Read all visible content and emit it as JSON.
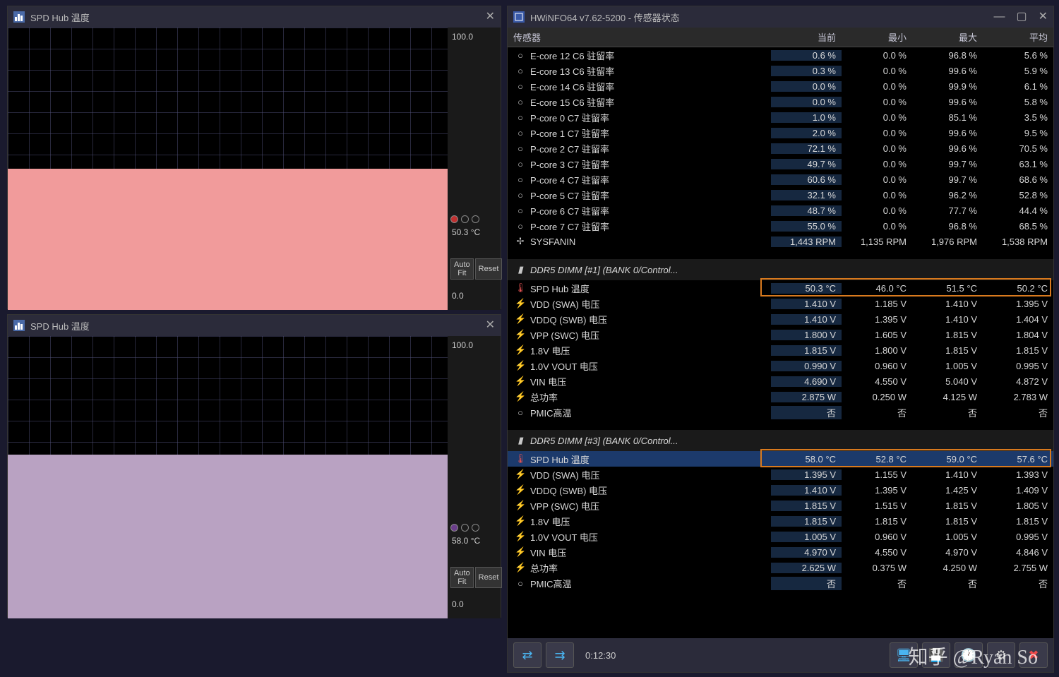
{
  "graph1": {
    "title": "SPD Hub 温度",
    "ymax": "100.0",
    "current": "50.3 °C",
    "ymin": "0.0",
    "autofit": "Auto Fit",
    "reset": "Reset",
    "fill_color": "#f19b9b",
    "fill_pct": 50,
    "dot_color": "#c03030"
  },
  "graph2": {
    "title": "SPD Hub 温度",
    "ymax": "100.0",
    "current": "58.0 °C",
    "ymin": "0.0",
    "autofit": "Auto Fit",
    "reset": "Reset",
    "fill_color": "#b9a2c2",
    "fill_pct": 58,
    "dot_color": "#6a3d8a"
  },
  "hwinfo": {
    "title": "HWiNFO64 v7.62-5200 - 传感器状态",
    "headers": {
      "sensor": "传感器",
      "cur": "当前",
      "min": "最小",
      "max": "最大",
      "avg": "平均"
    },
    "timer": "0:12:30",
    "rows": [
      {
        "type": "item",
        "icon": "○",
        "name": "E-core 12 C6 驻留率",
        "cur": "0.6 %",
        "min": "0.0 %",
        "max": "96.8 %",
        "avg": "5.6 %"
      },
      {
        "type": "item",
        "icon": "○",
        "name": "E-core 13 C6 驻留率",
        "cur": "0.3 %",
        "min": "0.0 %",
        "max": "99.6 %",
        "avg": "5.9 %"
      },
      {
        "type": "item",
        "icon": "○",
        "name": "E-core 14 C6 驻留率",
        "cur": "0.0 %",
        "min": "0.0 %",
        "max": "99.9 %",
        "avg": "6.1 %"
      },
      {
        "type": "item",
        "icon": "○",
        "name": "E-core 15 C6 驻留率",
        "cur": "0.0 %",
        "min": "0.0 %",
        "max": "99.6 %",
        "avg": "5.8 %"
      },
      {
        "type": "item",
        "icon": "○",
        "name": "P-core 0 C7 驻留率",
        "cur": "1.0 %",
        "min": "0.0 %",
        "max": "85.1 %",
        "avg": "3.5 %"
      },
      {
        "type": "item",
        "icon": "○",
        "name": "P-core 1 C7 驻留率",
        "cur": "2.0 %",
        "min": "0.0 %",
        "max": "99.6 %",
        "avg": "9.5 %"
      },
      {
        "type": "item",
        "icon": "○",
        "name": "P-core 2 C7 驻留率",
        "cur": "72.1 %",
        "min": "0.0 %",
        "max": "99.6 %",
        "avg": "70.5 %"
      },
      {
        "type": "item",
        "icon": "○",
        "name": "P-core 3 C7 驻留率",
        "cur": "49.7 %",
        "min": "0.0 %",
        "max": "99.7 %",
        "avg": "63.1 %"
      },
      {
        "type": "item",
        "icon": "○",
        "name": "P-core 4 C7 驻留率",
        "cur": "60.6 %",
        "min": "0.0 %",
        "max": "99.7 %",
        "avg": "68.6 %"
      },
      {
        "type": "item",
        "icon": "○",
        "name": "P-core 5 C7 驻留率",
        "cur": "32.1 %",
        "min": "0.0 %",
        "max": "96.2 %",
        "avg": "52.8 %"
      },
      {
        "type": "item",
        "icon": "○",
        "name": "P-core 6 C7 驻留率",
        "cur": "48.7 %",
        "min": "0.0 %",
        "max": "77.7 %",
        "avg": "44.4 %"
      },
      {
        "type": "item",
        "icon": "○",
        "name": "P-core 7 C7 驻留率",
        "cur": "55.0 %",
        "min": "0.0 %",
        "max": "96.8 %",
        "avg": "68.5 %"
      },
      {
        "type": "item",
        "icon": "✢",
        "name": "SYSFANIN",
        "cur": "1,443 RPM",
        "min": "1,135 RPM",
        "max": "1,976 RPM",
        "avg": "1,538 RPM"
      },
      {
        "type": "spacer"
      },
      {
        "type": "group",
        "icon": "▮",
        "name": "DDR5 DIMM [#1] (BANK 0/Control..."
      },
      {
        "type": "item",
        "icon": "🌡",
        "name": "SPD Hub 温度",
        "cur": "50.3 °C",
        "min": "46.0 °C",
        "max": "51.5 °C",
        "avg": "50.2 °C",
        "hl": true
      },
      {
        "type": "item",
        "icon": "⚡",
        "name": "VDD (SWA) 电压",
        "cur": "1.410 V",
        "min": "1.185 V",
        "max": "1.410 V",
        "avg": "1.395 V"
      },
      {
        "type": "item",
        "icon": "⚡",
        "name": "VDDQ (SWB) 电压",
        "cur": "1.410 V",
        "min": "1.395 V",
        "max": "1.410 V",
        "avg": "1.404 V"
      },
      {
        "type": "item",
        "icon": "⚡",
        "name": "VPP (SWC) 电压",
        "cur": "1.800 V",
        "min": "1.605 V",
        "max": "1.815 V",
        "avg": "1.804 V"
      },
      {
        "type": "item",
        "icon": "⚡",
        "name": "1.8V 电压",
        "cur": "1.815 V",
        "min": "1.800 V",
        "max": "1.815 V",
        "avg": "1.815 V"
      },
      {
        "type": "item",
        "icon": "⚡",
        "name": "1.0V VOUT 电压",
        "cur": "0.990 V",
        "min": "0.960 V",
        "max": "1.005 V",
        "avg": "0.995 V"
      },
      {
        "type": "item",
        "icon": "⚡",
        "name": "VIN 电压",
        "cur": "4.690 V",
        "min": "4.550 V",
        "max": "5.040 V",
        "avg": "4.872 V"
      },
      {
        "type": "item",
        "icon": "⚡",
        "name": "总功率",
        "cur": "2.875 W",
        "min": "0.250 W",
        "max": "4.125 W",
        "avg": "2.783 W"
      },
      {
        "type": "item",
        "icon": "○",
        "name": "PMIC高温",
        "cur": "否",
        "min": "否",
        "max": "否",
        "avg": "否"
      },
      {
        "type": "spacer"
      },
      {
        "type": "group",
        "icon": "▮",
        "name": "DDR5 DIMM [#3] (BANK 0/Control..."
      },
      {
        "type": "item",
        "icon": "🌡",
        "name": "SPD Hub 温度",
        "cur": "58.0 °C",
        "min": "52.8 °C",
        "max": "59.0 °C",
        "avg": "57.6 °C",
        "sel": true,
        "hl": true
      },
      {
        "type": "item",
        "icon": "⚡",
        "name": "VDD (SWA) 电压",
        "cur": "1.395 V",
        "min": "1.155 V",
        "max": "1.410 V",
        "avg": "1.393 V"
      },
      {
        "type": "item",
        "icon": "⚡",
        "name": "VDDQ (SWB) 电压",
        "cur": "1.410 V",
        "min": "1.395 V",
        "max": "1.425 V",
        "avg": "1.409 V"
      },
      {
        "type": "item",
        "icon": "⚡",
        "name": "VPP (SWC) 电压",
        "cur": "1.815 V",
        "min": "1.515 V",
        "max": "1.815 V",
        "avg": "1.805 V"
      },
      {
        "type": "item",
        "icon": "⚡",
        "name": "1.8V 电压",
        "cur": "1.815 V",
        "min": "1.815 V",
        "max": "1.815 V",
        "avg": "1.815 V"
      },
      {
        "type": "item",
        "icon": "⚡",
        "name": "1.0V VOUT 电压",
        "cur": "1.005 V",
        "min": "0.960 V",
        "max": "1.005 V",
        "avg": "0.995 V"
      },
      {
        "type": "item",
        "icon": "⚡",
        "name": "VIN 电压",
        "cur": "4.970 V",
        "min": "4.550 V",
        "max": "4.970 V",
        "avg": "4.846 V"
      },
      {
        "type": "item",
        "icon": "⚡",
        "name": "总功率",
        "cur": "2.625 W",
        "min": "0.375 W",
        "max": "4.250 W",
        "avg": "2.755 W"
      },
      {
        "type": "item",
        "icon": "○",
        "name": "PMIC高温",
        "cur": "否",
        "min": "否",
        "max": "否",
        "avg": "否"
      }
    ]
  },
  "watermark": "知乎 @Ryan So"
}
